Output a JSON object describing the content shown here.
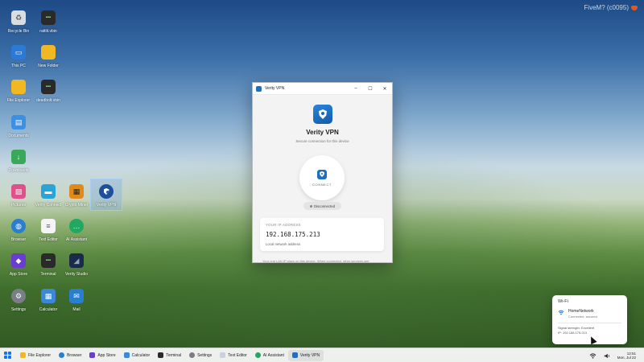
{
  "watermark": {
    "text": "FiveM? (c0095)"
  },
  "desktop": {
    "icons": [
      {
        "label": "Recycle Bin",
        "icon": "recycle-bin-icon",
        "color": "#d8dde3"
      },
      {
        "label": "rattlit.vbin",
        "icon": "terminal-icon",
        "color": "#2a2a2a"
      },
      {
        "label": "This PC",
        "icon": "monitor-icon",
        "color": "#2b7ad8"
      },
      {
        "label": "New Folder",
        "icon": "folder-icon",
        "color": "#f2b824"
      },
      {
        "label": "File Explorer",
        "icon": "folder-icon",
        "color": "#f2b824"
      },
      {
        "label": "deadbolt.vbin",
        "icon": "terminal-icon",
        "color": "#2a2a2a"
      },
      {
        "label": "Documents",
        "icon": "document-folder-icon",
        "color": "#3d8fe0"
      },
      {
        "label": "Downloads",
        "icon": "download-folder-icon",
        "color": "#3aa85a"
      },
      {
        "label": "Pictures",
        "icon": "pictures-icon",
        "color": "#e0508a"
      },
      {
        "label": "Verity Connect",
        "icon": "chat-icon",
        "color": "#2aa4d8"
      },
      {
        "label": "Crypto Miner",
        "icon": "chip-icon",
        "color": "#e08a1e"
      },
      {
        "label": "Verity VPN",
        "icon": "shield-icon",
        "color": "#1e6fc4"
      },
      {
        "label": "Browser",
        "icon": "globe-icon",
        "color": "#2a7ed0"
      },
      {
        "label": "Text Editor",
        "icon": "text-editor-icon",
        "color": "#f4f4f4"
      },
      {
        "label": "AI Assistant",
        "icon": "ai-chat-icon",
        "color": "#22a860"
      },
      {
        "label": "App Store",
        "icon": "store-icon",
        "color": "#6a3ccf"
      },
      {
        "label": "Terminal",
        "icon": "terminal-icon",
        "color": "#2a2a2a"
      },
      {
        "label": "Verity Studio",
        "icon": "studio-icon",
        "color": "#1c2a4a"
      },
      {
        "label": "Settings",
        "icon": "gear-icon",
        "color": "#7a7f87"
      },
      {
        "label": "Calculator",
        "icon": "calculator-icon",
        "color": "#3c88d8"
      },
      {
        "label": "Mail",
        "icon": "mail-icon",
        "color": "#2a7ed0"
      }
    ]
  },
  "vpn_window": {
    "title": "Verity VPN",
    "minimize": "–",
    "maximize": "☐",
    "close": "✕",
    "app_name": "Verity VPN",
    "subtitle": "Secure connection for this device",
    "connect_label": "CONNECT",
    "status": "Disconnected",
    "ip_header": "YOUR IP ADDRESS",
    "ip_value": "192.168.175.213",
    "ip_caption": "Local network address",
    "footnote": "Your real LAN IP stays on this device. When connected, other services see"
  },
  "wifi_panel": {
    "title": "Wi-Fi",
    "network_name": "HomeNetwork",
    "network_status": "Connected, secured",
    "signal": "Signal strength: Excellent",
    "ip": "IP: 192.168.175.213"
  },
  "taskbar": {
    "items": [
      {
        "label": "File Explorer",
        "color": "#f2b824"
      },
      {
        "label": "Browser",
        "color": "#2a7ed0"
      },
      {
        "label": "App Store",
        "color": "#6a3ccf"
      },
      {
        "label": "Calculator",
        "color": "#3c88d8"
      },
      {
        "label": "Terminal",
        "color": "#2a2a2a"
      },
      {
        "label": "Settings",
        "color": "#7a7f87"
      },
      {
        "label": "Text Editor",
        "color": "#c9d3de"
      },
      {
        "label": "AI Assistant",
        "color": "#22a860"
      },
      {
        "label": "Verity VPN",
        "color": "#1e6fc4"
      }
    ],
    "time": "12:51",
    "date": "Mon, Jul 22"
  }
}
